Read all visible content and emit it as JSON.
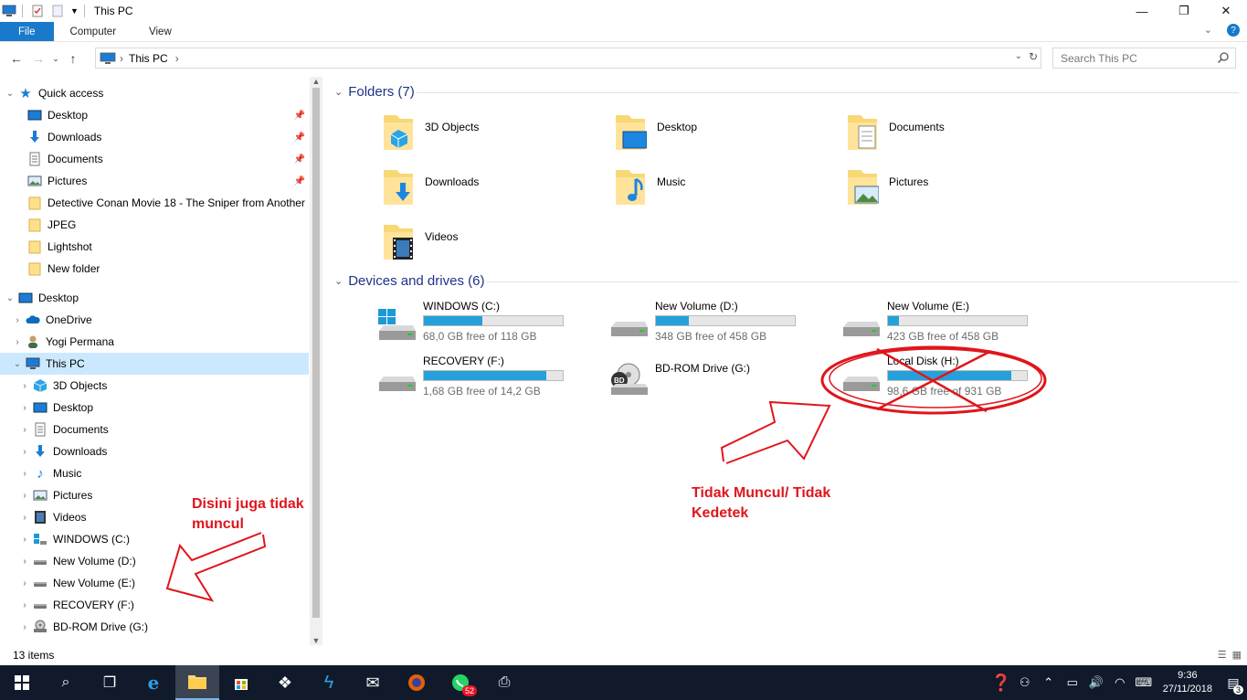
{
  "window": {
    "title": "This PC",
    "min_glyph": "—",
    "max_glyph": "❐",
    "close_glyph": "✕"
  },
  "ribbon": {
    "tabs": [
      "File",
      "Computer",
      "View"
    ],
    "expand_glyph": "⌄",
    "help_glyph": "?"
  },
  "address": {
    "crumb": "This PC",
    "search_placeholder": "Search This PC"
  },
  "nav": {
    "quick_access": {
      "label": "Quick access",
      "items": [
        {
          "label": "Desktop",
          "icon": "desktop-icon",
          "pinned": true
        },
        {
          "label": "Downloads",
          "icon": "downloads-icon",
          "pinned": true
        },
        {
          "label": "Documents",
          "icon": "documents-icon",
          "pinned": true
        },
        {
          "label": "Pictures",
          "icon": "pictures-icon",
          "pinned": true
        },
        {
          "label": "Detective Conan Movie 18 - The Sniper from Another",
          "icon": "folder-icon",
          "pinned": false
        },
        {
          "label": "JPEG",
          "icon": "folder-icon",
          "pinned": false
        },
        {
          "label": "Lightshot",
          "icon": "folder-icon",
          "pinned": false
        },
        {
          "label": "New folder",
          "icon": "folder-icon",
          "pinned": false
        }
      ]
    },
    "desktop": {
      "label": "Desktop",
      "children": [
        {
          "label": "OneDrive",
          "icon": "onedrive-icon"
        },
        {
          "label": "Yogi Permana",
          "icon": "user-icon"
        },
        {
          "label": "This PC",
          "icon": "this-pc-icon"
        }
      ]
    },
    "this_pc_children": [
      {
        "label": "3D Objects",
        "icon": "3d-objects-icon"
      },
      {
        "label": "Desktop",
        "icon": "desktop-icon"
      },
      {
        "label": "Documents",
        "icon": "documents-icon"
      },
      {
        "label": "Downloads",
        "icon": "downloads-icon"
      },
      {
        "label": "Music",
        "icon": "music-icon"
      },
      {
        "label": "Pictures",
        "icon": "pictures-icon"
      },
      {
        "label": "Videos",
        "icon": "videos-icon"
      },
      {
        "label": "WINDOWS (C:)",
        "icon": "windows-drive-icon"
      },
      {
        "label": "New Volume (D:)",
        "icon": "drive-icon"
      },
      {
        "label": "New Volume (E:)",
        "icon": "drive-icon"
      },
      {
        "label": "RECOVERY (F:)",
        "icon": "drive-icon"
      },
      {
        "label": "BD-ROM Drive (G:)",
        "icon": "bd-rom-icon"
      }
    ]
  },
  "content": {
    "folders_header": "Folders (7)",
    "folders": [
      {
        "name": "3D Objects",
        "icon": "3d-objects-folder-icon"
      },
      {
        "name": "Desktop",
        "icon": "desktop-folder-icon"
      },
      {
        "name": "Documents",
        "icon": "documents-folder-icon"
      },
      {
        "name": "Downloads",
        "icon": "downloads-folder-icon"
      },
      {
        "name": "Music",
        "icon": "music-folder-icon"
      },
      {
        "name": "Pictures",
        "icon": "pictures-folder-icon"
      },
      {
        "name": "Videos",
        "icon": "videos-folder-icon"
      }
    ],
    "drives_header": "Devices and drives (6)",
    "drives": [
      {
        "name": "WINDOWS (C:)",
        "free": "68,0 GB free of 118 GB",
        "used_fraction": 0.42,
        "icon": "windows-drive-icon",
        "has_bar": true
      },
      {
        "name": "New Volume (D:)",
        "free": "348 GB free of 458 GB",
        "used_fraction": 0.24,
        "icon": "drive-icon",
        "has_bar": true
      },
      {
        "name": "New Volume (E:)",
        "free": "423 GB free of 458 GB",
        "used_fraction": 0.08,
        "icon": "drive-icon",
        "has_bar": true
      },
      {
        "name": "RECOVERY (F:)",
        "free": "1,68 GB free of 14,2 GB",
        "used_fraction": 0.88,
        "icon": "drive-icon",
        "has_bar": true
      },
      {
        "name": "BD-ROM Drive (G:)",
        "free": "",
        "used_fraction": 0,
        "icon": "bd-rom-icon",
        "has_bar": false
      },
      {
        "name": "Local Disk (H:)",
        "free": "98,6 GB free of 931 GB",
        "used_fraction": 0.89,
        "icon": "drive-icon",
        "has_bar": true
      }
    ]
  },
  "status": {
    "items_count": "13 items"
  },
  "annotations": {
    "left_note": "Disini juga tidak muncul",
    "right_note": "Tidak Muncul/ Tidak Kedetek",
    "color": "#e0151c"
  },
  "taskbar": {
    "whatsapp_badge": "52",
    "clock_time": "9:36",
    "clock_date": "27/11/2018",
    "notification_count": "3"
  },
  "colors": {
    "accent": "#1979ca",
    "bar_fill": "#26a0da",
    "group_header": "#1e3287",
    "selected_bg": "#cce8ff",
    "taskbar_bg": "#101a2b"
  }
}
